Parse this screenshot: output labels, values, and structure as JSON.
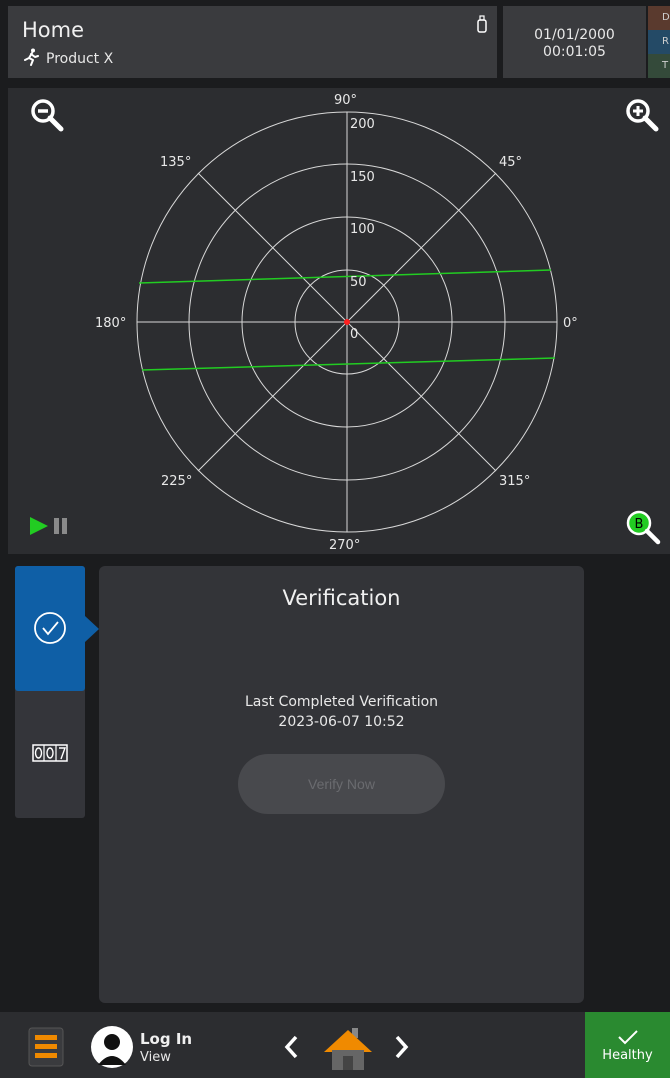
{
  "header": {
    "title": "Home",
    "product": "Product X",
    "date": "01/01/2000",
    "time": "00:01:05",
    "side_tags": [
      {
        "label": "D",
        "color": "#5a3a2e"
      },
      {
        "label": "R",
        "color": "#244a66"
      },
      {
        "label": "T",
        "color": "#344a3a"
      }
    ]
  },
  "polar": {
    "angle_labels": [
      "90°",
      "45°",
      "0°",
      "315°",
      "270°",
      "225°",
      "180°",
      "135°"
    ],
    "radius_labels": [
      "200",
      "150",
      "100",
      "50",
      "0"
    ],
    "beam_label": "B",
    "colors": {
      "beam": "#22cc22",
      "center": "#ff2020",
      "grid": "#d8d8d8",
      "play": "#22cc22"
    }
  },
  "rail": {
    "items": [
      {
        "name": "verification",
        "icon": "check-circle-icon",
        "active": true
      },
      {
        "name": "counter",
        "icon": "counter-icon",
        "active": false
      }
    ]
  },
  "card": {
    "title": "Verification",
    "last_label": "Last Completed Verification",
    "last_date": "2023-06-07 10:52",
    "button_label": "Verify Now"
  },
  "footer": {
    "login": "Log In",
    "view": "View",
    "status": "Healthy",
    "colors": {
      "menu": "#f08a00",
      "home": "#f08a00",
      "healthy": "#2a8a30"
    }
  }
}
